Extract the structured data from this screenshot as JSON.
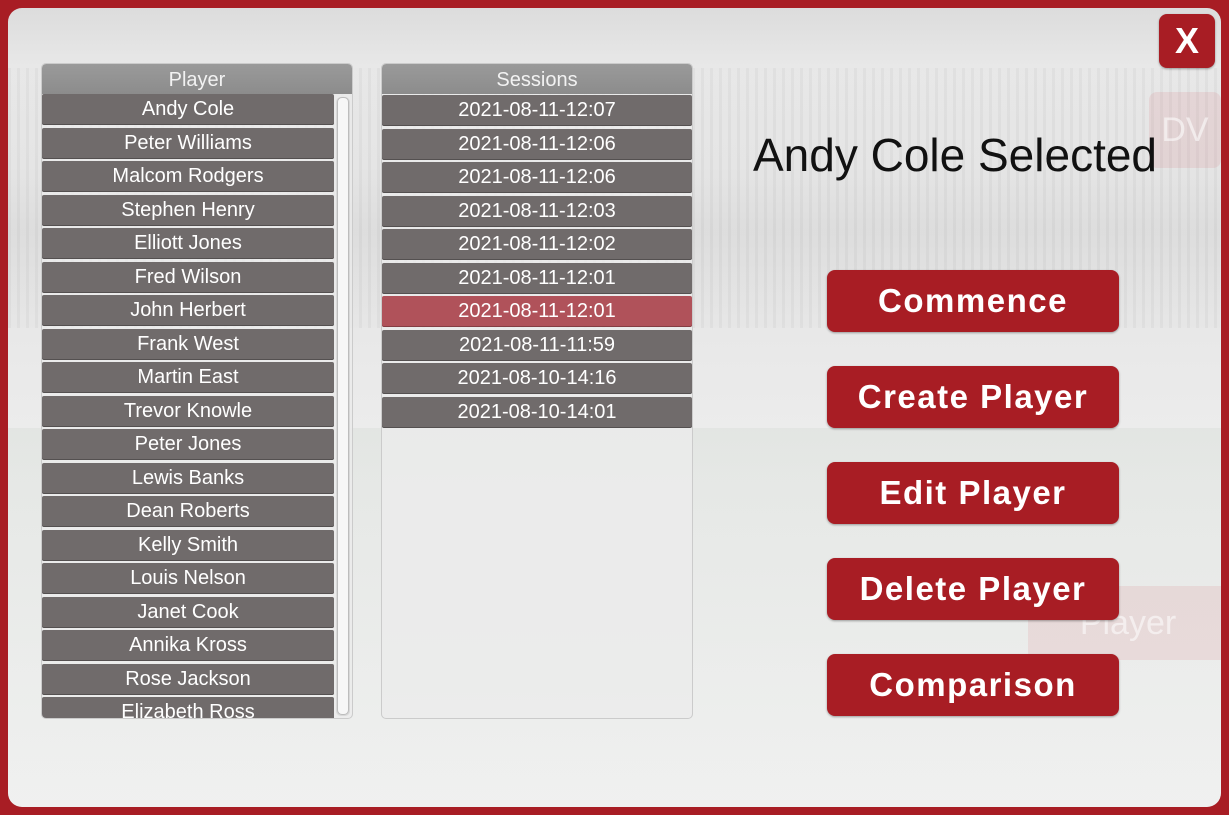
{
  "close_label": "X",
  "background_labels": {
    "dv": "DV",
    "player": "Player"
  },
  "players_panel": {
    "header": "Player",
    "items": [
      "Andy Cole",
      "Peter Williams",
      "Malcom Rodgers",
      "Stephen Henry",
      "Elliott Jones",
      "Fred Wilson",
      "John Herbert",
      "Frank West",
      "Martin East",
      "Trevor Knowle",
      "Peter Jones",
      "Lewis Banks",
      "Dean Roberts",
      "Kelly Smith",
      "Louis Nelson",
      "Janet Cook",
      "Annika Kross",
      "Rose Jackson",
      "Elizabeth Ross"
    ]
  },
  "sessions_panel": {
    "header": "Sessions",
    "selected_index": 6,
    "items": [
      "2021-08-11-12:07",
      "2021-08-11-12:06",
      "2021-08-11-12:06",
      "2021-08-11-12:03",
      "2021-08-11-12:02",
      "2021-08-11-12:01",
      "2021-08-11-12:01",
      "2021-08-11-11:59",
      "2021-08-10-14:16",
      "2021-08-10-14:01"
    ]
  },
  "selection_text": "Andy Cole Selected",
  "actions": {
    "commence": "Commence",
    "create_player": "Create Player",
    "edit_player": "Edit Player",
    "delete_player": "Delete Player",
    "comparison": "Comparison"
  },
  "colors": {
    "accent": "#a81d24",
    "row": "#706b6b",
    "row_selected": "#b0525a"
  }
}
